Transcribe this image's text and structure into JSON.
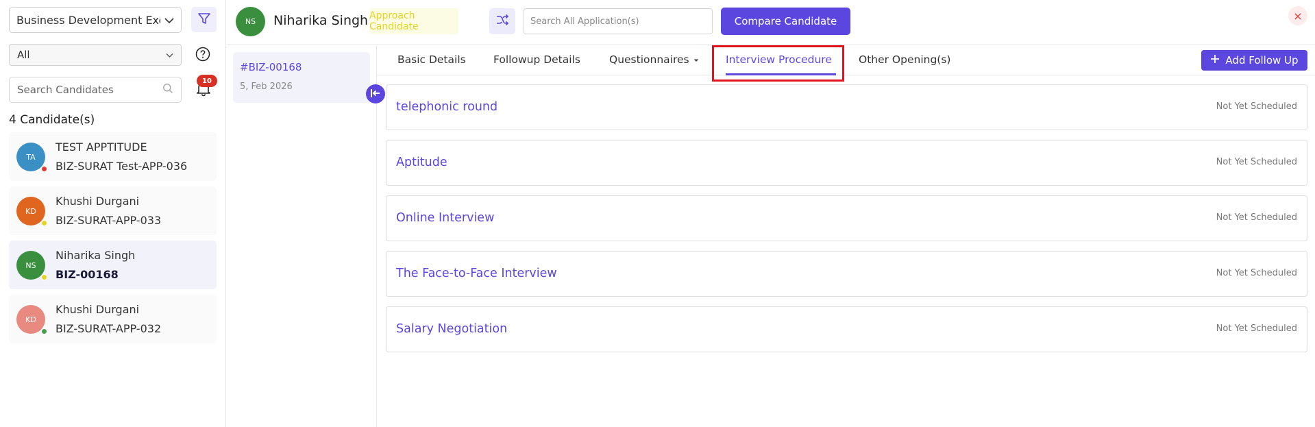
{
  "sidebar": {
    "job_select": "Business Development Exec",
    "status_select": "All",
    "search_placeholder": "Search Candidates",
    "notification_count": "10",
    "candidate_count_label": "4 Candidate(s)",
    "candidates": [
      {
        "initials": "TA",
        "name": "TEST APPTITUDE",
        "code": "BIZ-SURAT Test-APP-036",
        "avatar_color": "#3a8fc4",
        "dot_color": "#e53935"
      },
      {
        "initials": "KD",
        "name": "Khushi Durgani",
        "code": "BIZ-SURAT-APP-033",
        "avatar_color": "#e0651f",
        "dot_color": "#e6d520"
      },
      {
        "initials": "NS",
        "name": "Niharika Singh",
        "code": "BIZ-00168",
        "avatar_color": "#3a8f3f",
        "dot_color": "#e6d520"
      },
      {
        "initials": "KD",
        "name": "Khushi Durgani",
        "code": "BIZ-SURAT-APP-032",
        "avatar_color": "#e88a80",
        "dot_color": "#43a047"
      }
    ]
  },
  "header": {
    "avatar_initials": "NS",
    "candidate_name": "Niharika Singh",
    "approach_label": "Approach Candidate",
    "search_placeholder": "Search All Application(s)",
    "compare_label": "Compare Candidate",
    "close_label": "×"
  },
  "application": {
    "id": "#BIZ-00168",
    "date": "5, Feb 2026"
  },
  "tabs": [
    {
      "label": "Basic Details"
    },
    {
      "label": "Followup Details"
    },
    {
      "label": "Questionnaires"
    },
    {
      "label": "Interview Procedure"
    },
    {
      "label": "Other Opening(s)"
    }
  ],
  "add_follow_up_label": "Add Follow Up",
  "rounds": [
    {
      "title": "telephonic round",
      "status": "Not Yet Scheduled"
    },
    {
      "title": "Aptitude",
      "status": "Not Yet Scheduled"
    },
    {
      "title": "Online Interview",
      "status": "Not Yet Scheduled"
    },
    {
      "title": "The Face-to-Face Interview",
      "status": "Not Yet Scheduled"
    },
    {
      "title": "Salary Negotiation",
      "status": "Not Yet Scheduled"
    }
  ],
  "colors": {
    "accent": "#5b47e0",
    "highlight": "#e0141a",
    "approach_text": "#e6d520"
  }
}
